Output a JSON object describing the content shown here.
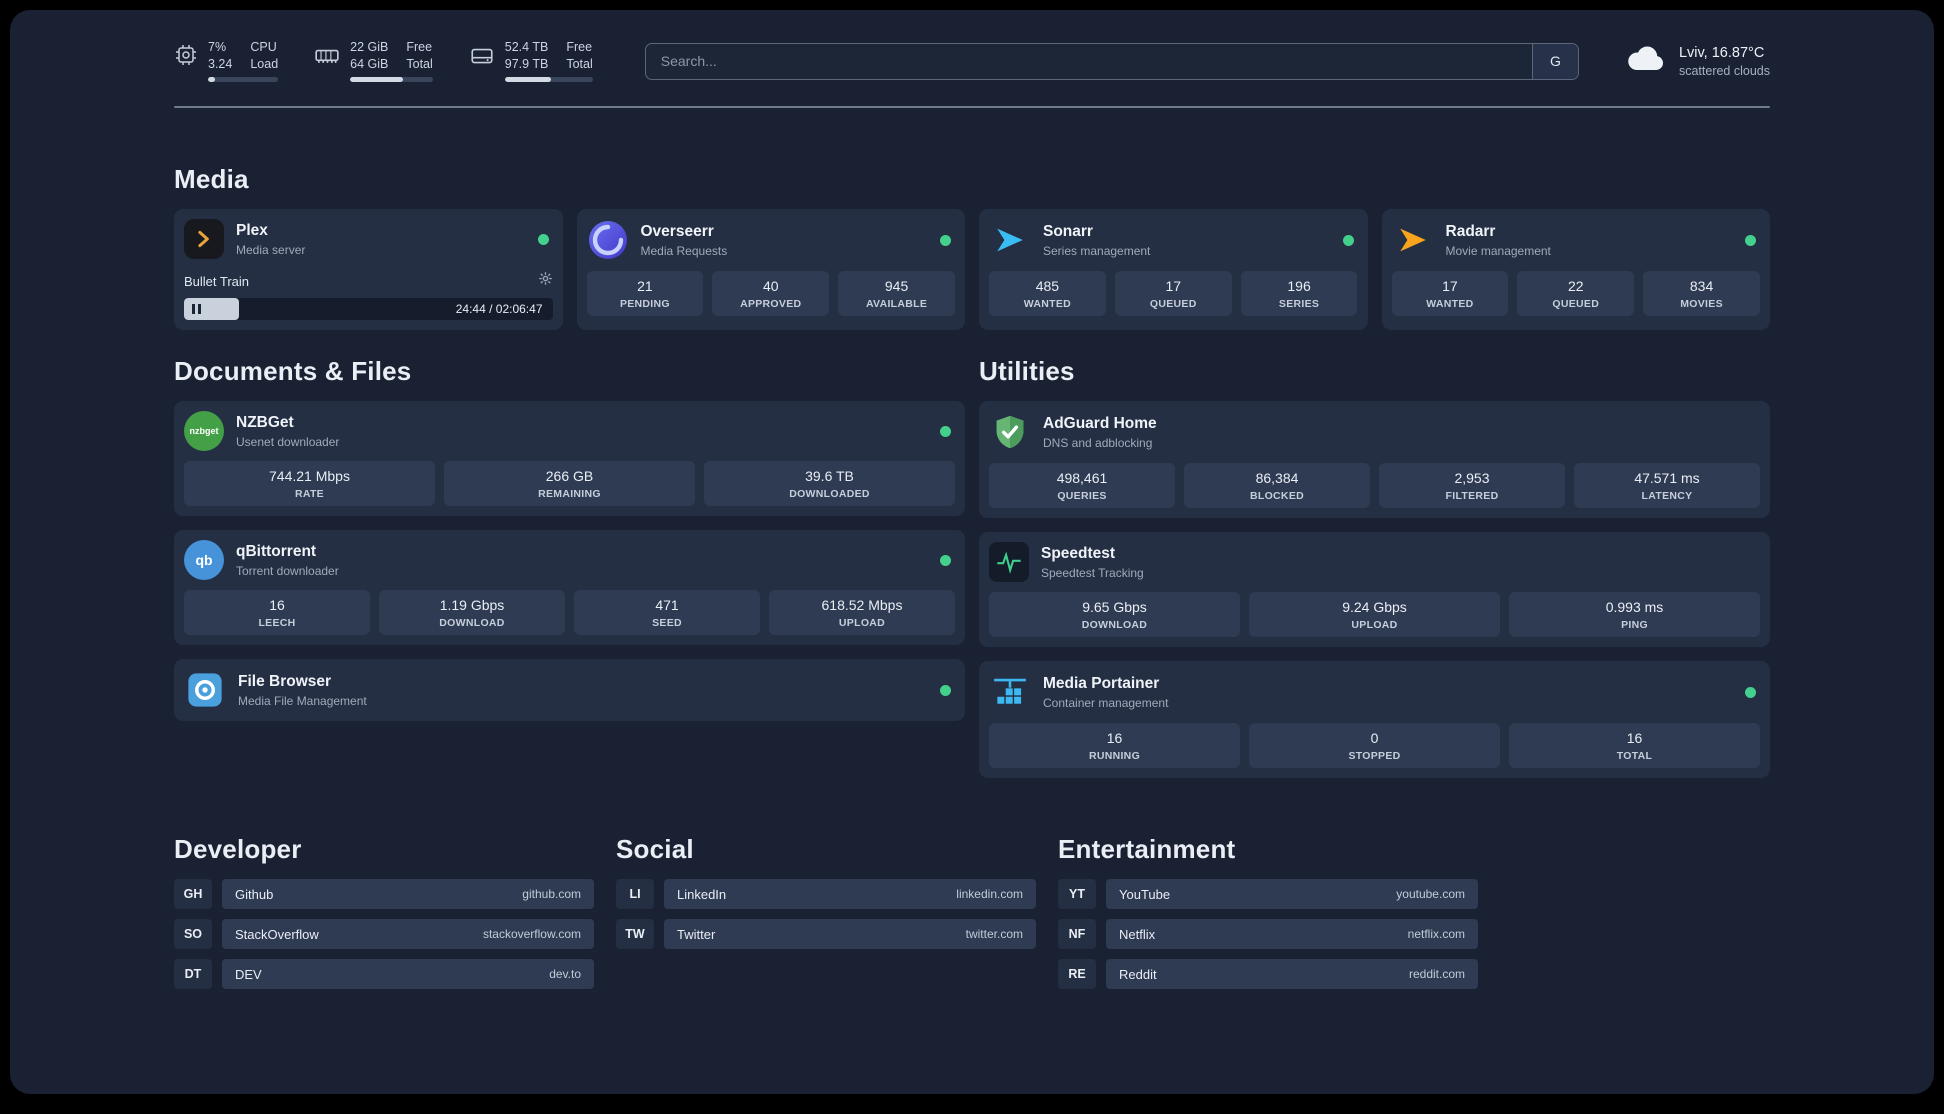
{
  "topbar": {
    "cpu": {
      "row1_value": "7%",
      "row1_label": "CPU",
      "row2_value": "3.24",
      "row2_label": "Load",
      "progress_pct": 10
    },
    "memory": {
      "row1_value": "22 GiB",
      "row1_label": "Free",
      "row2_value": "64 GiB",
      "row2_label": "Total",
      "progress_pct": 64
    },
    "storage": {
      "row1_value": "52.4 TB",
      "row1_label": "Free",
      "row2_value": "97.9 TB",
      "row2_label": "Total",
      "progress_pct": 52
    },
    "search": {
      "placeholder": "Search...",
      "engine_button": "G"
    },
    "weather": {
      "location": "Lviv, 16.87°C",
      "condition": "scattered clouds"
    }
  },
  "sections": {
    "media": {
      "title": "Media",
      "plex": {
        "name": "Plex",
        "subtitle": "Media server",
        "now_playing": {
          "title": "Bullet Train",
          "time": "24:44 / 02:06:47",
          "progress_pct": 15
        }
      },
      "overseerr": {
        "name": "Overseerr",
        "subtitle": "Media Requests",
        "stats": [
          {
            "value": "21",
            "label": "PENDING"
          },
          {
            "value": "40",
            "label": "APPROVED"
          },
          {
            "value": "945",
            "label": "AVAILABLE"
          }
        ]
      },
      "sonarr": {
        "name": "Sonarr",
        "subtitle": "Series management",
        "stats": [
          {
            "value": "485",
            "label": "WANTED"
          },
          {
            "value": "17",
            "label": "QUEUED"
          },
          {
            "value": "196",
            "label": "SERIES"
          }
        ]
      },
      "radarr": {
        "name": "Radarr",
        "subtitle": "Movie management",
        "stats": [
          {
            "value": "17",
            "label": "WANTED"
          },
          {
            "value": "22",
            "label": "QUEUED"
          },
          {
            "value": "834",
            "label": "MOVIES"
          }
        ]
      }
    },
    "documents": {
      "title": "Documents & Files",
      "nzbget": {
        "name": "NZBGet",
        "subtitle": "Usenet downloader",
        "icon_text": "nzbget",
        "stats": [
          {
            "value": "744.21 Mbps",
            "label": "RATE"
          },
          {
            "value": "266 GB",
            "label": "REMAINING"
          },
          {
            "value": "39.6 TB",
            "label": "DOWNLOADED"
          }
        ]
      },
      "qbittorrent": {
        "name": "qBittorrent",
        "subtitle": "Torrent downloader",
        "icon_text": "qb",
        "stats": [
          {
            "value": "16",
            "label": "LEECH"
          },
          {
            "value": "1.19 Gbps",
            "label": "DOWNLOAD"
          },
          {
            "value": "471",
            "label": "SEED"
          },
          {
            "value": "618.52 Mbps",
            "label": "UPLOAD"
          }
        ]
      },
      "filebrowser": {
        "name": "File Browser",
        "subtitle": "Media File Management"
      }
    },
    "utilities": {
      "title": "Utilities",
      "adguard": {
        "name": "AdGuard Home",
        "subtitle": "DNS and adblocking",
        "stats": [
          {
            "value": "498,461",
            "label": "QUERIES"
          },
          {
            "value": "86,384",
            "label": "BLOCKED"
          },
          {
            "value": "2,953",
            "label": "FILTERED"
          },
          {
            "value": "47.571 ms",
            "label": "LATENCY"
          }
        ]
      },
      "speedtest": {
        "name": "Speedtest",
        "subtitle": "Speedtest Tracking",
        "stats": [
          {
            "value": "9.65 Gbps",
            "label": "DOWNLOAD"
          },
          {
            "value": "9.24 Gbps",
            "label": "UPLOAD"
          },
          {
            "value": "0.993 ms",
            "label": "PING"
          }
        ]
      },
      "portainer": {
        "name": "Media Portainer",
        "subtitle": "Container management",
        "stats": [
          {
            "value": "16",
            "label": "RUNNING"
          },
          {
            "value": "0",
            "label": "STOPPED"
          },
          {
            "value": "16",
            "label": "TOTAL"
          }
        ]
      }
    },
    "developer": {
      "title": "Developer",
      "bookmarks": [
        {
          "abbr": "GH",
          "name": "Github",
          "url": "github.com"
        },
        {
          "abbr": "SO",
          "name": "StackOverflow",
          "url": "stackoverflow.com"
        },
        {
          "abbr": "DT",
          "name": "DEV",
          "url": "dev.to"
        }
      ]
    },
    "social": {
      "title": "Social",
      "bookmarks": [
        {
          "abbr": "LI",
          "name": "LinkedIn",
          "url": "linkedin.com"
        },
        {
          "abbr": "TW",
          "name": "Twitter",
          "url": "twitter.com"
        }
      ]
    },
    "entertainment": {
      "title": "Entertainment",
      "bookmarks": [
        {
          "abbr": "YT",
          "name": "YouTube",
          "url": "youtube.com"
        },
        {
          "abbr": "NF",
          "name": "Netflix",
          "url": "netflix.com"
        },
        {
          "abbr": "RE",
          "name": "Reddit",
          "url": "reddit.com"
        }
      ]
    }
  },
  "colors": {
    "status_online": "#43d08d",
    "accent_plex": "#e8a33d"
  }
}
